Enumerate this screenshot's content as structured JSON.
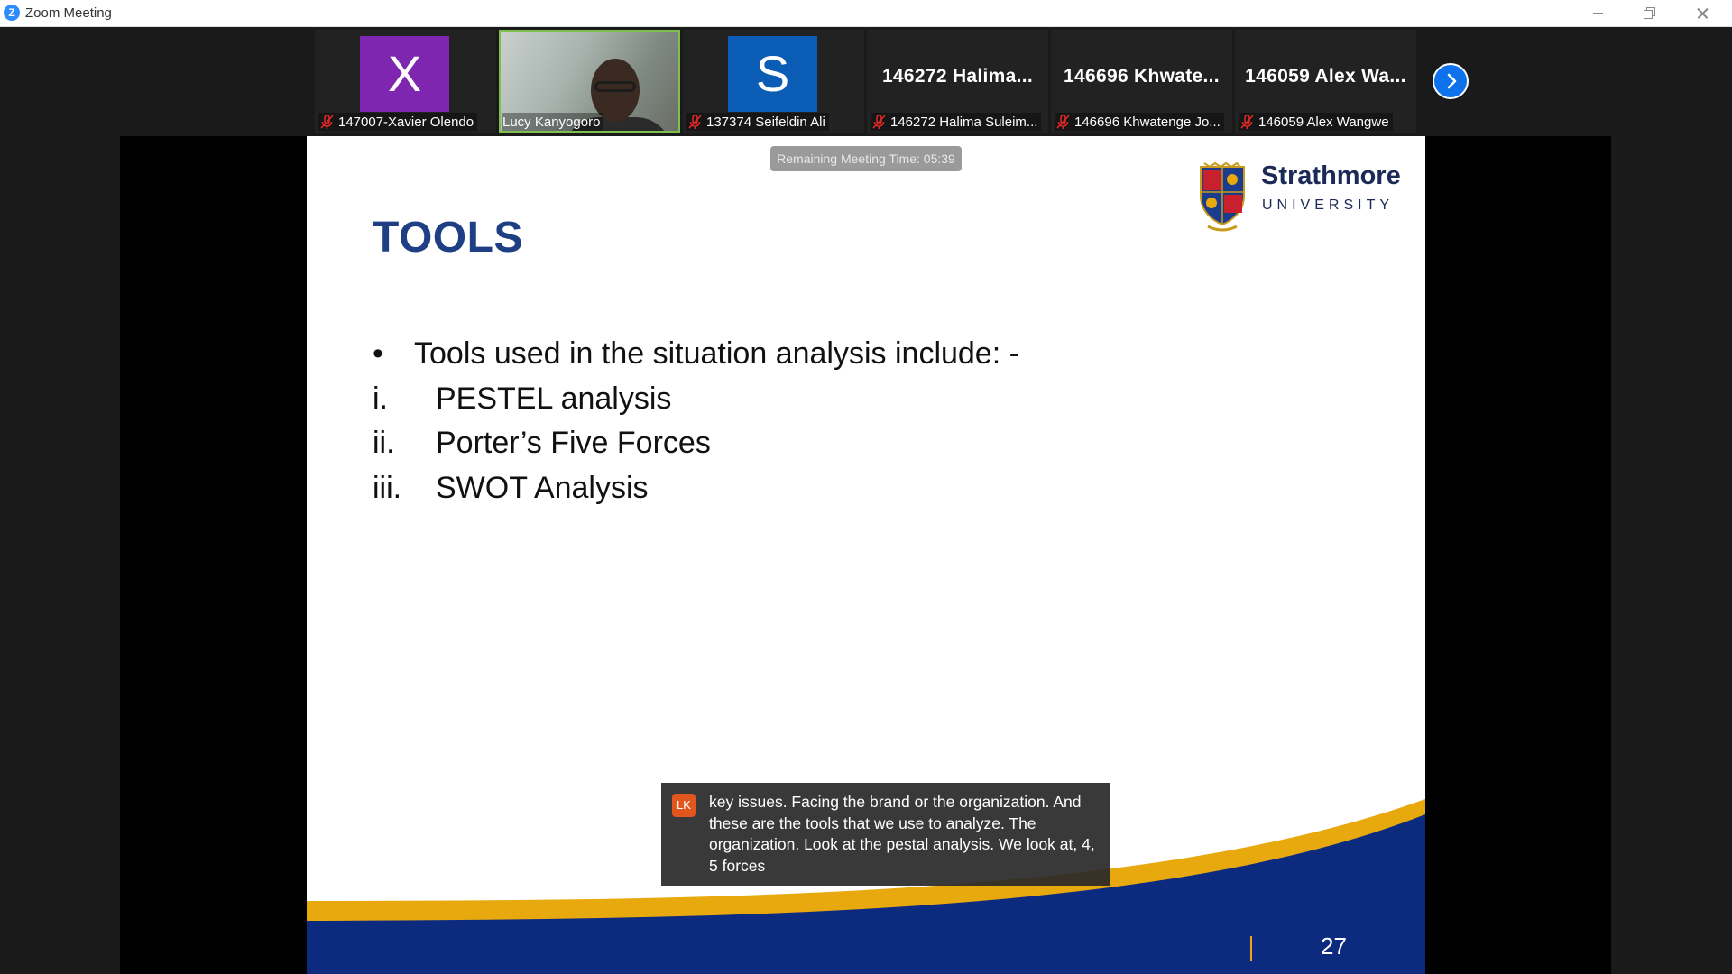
{
  "window": {
    "title": "Zoom Meeting",
    "app_icon": "Z"
  },
  "participants": [
    {
      "type": "avatar",
      "initial": "X",
      "avatar_color": "#7e26b0",
      "name": "147007-Xavier Olendo",
      "muted": true
    },
    {
      "type": "video",
      "name": "Lucy Kanyogoro",
      "muted": false,
      "speaking": true
    },
    {
      "type": "avatar",
      "initial": "S",
      "avatar_color": "#0b5cb5",
      "name": "137374 Seifeldin Ali",
      "muted": true
    },
    {
      "type": "name",
      "display": "146272  Halima...",
      "name": "146272 Halima Suleim...",
      "muted": true
    },
    {
      "type": "name",
      "display": "146696  Khwate...",
      "name": "146696 Khwatenge Jo...",
      "muted": true
    },
    {
      "type": "name",
      "display": "146059  Alex  Wa...",
      "name": "146059 Alex Wangwe",
      "muted": true
    }
  ],
  "meeting": {
    "remaining_time": "Remaining Meeting Time: 05:39"
  },
  "slide": {
    "title": "TOOLS",
    "bullet": "Tools used in the situation analysis include: -",
    "items": [
      {
        "num": "i.",
        "text": "PESTEL analysis"
      },
      {
        "num": "ii.",
        "text": "Porter’s Five Forces"
      },
      {
        "num": "iii.",
        "text": "SWOT Analysis"
      }
    ],
    "logo": {
      "name": "Strathmore",
      "sub": "UNIVERSITY"
    },
    "page_number": "27",
    "colors": {
      "title": "#1e3f84",
      "wave_blue": "#0d2b7e",
      "wave_gold": "#e8a90f"
    }
  },
  "caption": {
    "speaker_initials": "LK",
    "text": "key issues. Facing the brand or the organization. And these are the tools that we use to analyze. The organization. Look at the pestal analysis. We look at, 4, 5 forces"
  },
  "icons": {
    "mute": "mic-muted-icon",
    "next": "chevron-right-icon",
    "minimize": "minimize-icon",
    "restore": "restore-icon",
    "close": "close-icon"
  }
}
